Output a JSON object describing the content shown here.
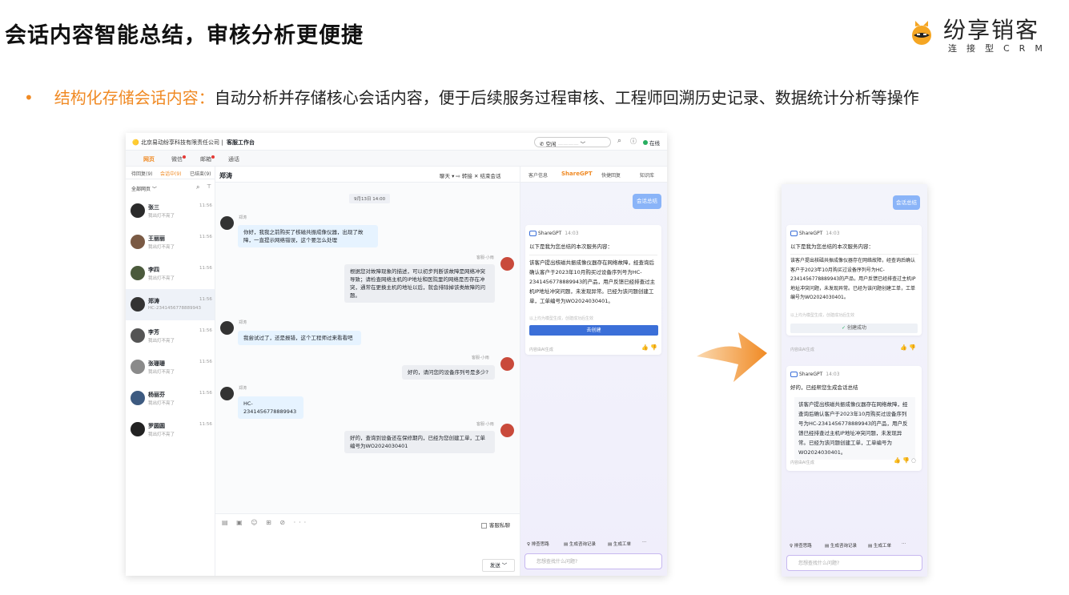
{
  "slide": {
    "title": "会话内容智能总结，审核分析更便捷",
    "bullet_dot": "•",
    "bullet_key": "结构化存储会话内容：",
    "bullet_text": "自动分析并存储核心会话内容，便于后续服务过程审核、工程师回溯历史记录、数据统计分析等操作"
  },
  "logo": {
    "name": "纷享销客",
    "sub": "连接型CRM"
  },
  "window": {
    "company": "北京易动纷享科技有限责任公司",
    "workbench": "客服工作台",
    "status_label": "空闲",
    "online": "在线",
    "channel_tabs": [
      "网页",
      "微信",
      "邮箱",
      "通话"
    ],
    "list_tabs": [
      "待回复(9)",
      "会话中(9)",
      "已结束(9)"
    ],
    "filter": "全部网页 ﹀",
    "contacts": [
      {
        "name": "张三",
        "sub": "我出灯不亮了",
        "time": "11:56"
      },
      {
        "name": "王丽丽",
        "sub": "我出灯不亮了",
        "time": "11:56"
      },
      {
        "name": "李四",
        "sub": "我出灯不亮了",
        "time": "11:56"
      },
      {
        "name": "郑涛",
        "sub": "HC-2341456778889943",
        "time": "11:56"
      },
      {
        "name": "李芳",
        "sub": "我出灯不亮了",
        "time": "11:56"
      },
      {
        "name": "张珊珊",
        "sub": "我出灯不亮了",
        "time": "11:56"
      },
      {
        "name": "杨丽芬",
        "sub": "我出灯不亮了",
        "time": "11:56"
      },
      {
        "name": "罗圆圆",
        "sub": "我出灯不亮了",
        "time": "11:56"
      }
    ],
    "chat": {
      "name": "郑涛",
      "actions": "聊天 ▾   ⇨ 转接   ✕ 结束会话",
      "date": "9月13日 14:00",
      "user_label": "郑涛",
      "agent_label": "客服-小雨",
      "messages": [
        "你好，我我之前购买了核磁共振成像仪器，出现了故障，一直提示网络错误，这个要怎么处理",
        "根据您对故障现象的描述，可以初步判断该故障是网络冲突导致；请检查网络主机的IP地址和医院里的网络是否存在冲突，通常在更换主机的地址以后，就会排除掉该类故障的问题。",
        "我尝试过了，还是报错，这个工程师过来看看吧",
        "好的，请问您的设备序列号是多少?",
        "HC-2341456778889943",
        "好的，查询到设备还在保修期内，已经为您创建工单，工单编号为WO2024030401"
      ],
      "tools": "▤ ▣ ☺ ⊞ ⊘ ···",
      "private_label": "客服私聊",
      "send": "发送 ﹀"
    },
    "right": {
      "tabs": [
        "客户信息",
        "ShareGPT",
        "快捷回复",
        "知识库"
      ],
      "summary_btn": "会话总结",
      "brand": "ShareGPT",
      "time": "14:03",
      "intro": "以下是我为您总结的本次服务内容：",
      "summary": "该客户提出核磁共振成像仪器存在网络故障，经查询后确认客户于2023年10月购买过设备序列号为HC-2341456778889943的产品，用户反馈已经排查过主机IP地址冲突问题，未发现异常。已经为该问题创建工单，工单编号为WO2024030401。",
      "hint": "以上均为模型生成，创建成功后生效",
      "create_btn": "去创建",
      "ai_note": "内容由AI生成",
      "quick": [
        "排查思路",
        "生成咨询记录",
        "生成工单",
        "···"
      ],
      "input_placeholder": "您想查找什么问题?"
    }
  },
  "phone": {
    "created": "创建成功",
    "second_intro": "好的，已经帮您生成会话总结"
  },
  "colors": {
    "accent": "#f08a24",
    "primary_btn": "#3b6fd8",
    "pill": "#8ab4f8"
  }
}
